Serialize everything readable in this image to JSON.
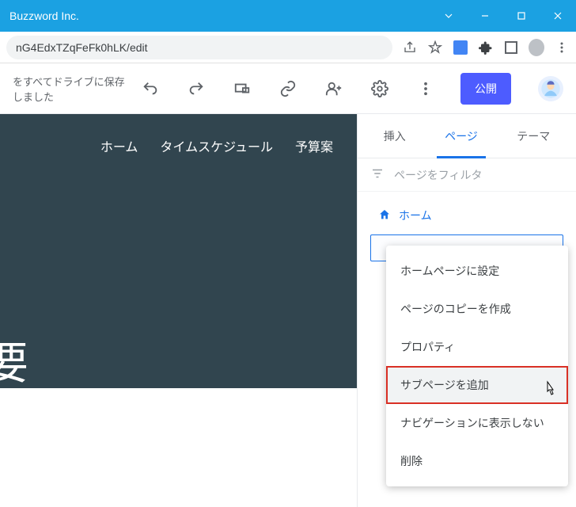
{
  "window": {
    "title": "Buzzword Inc."
  },
  "url": {
    "value": "nG4EdxTZqFeFk0hLK/edit"
  },
  "toolbar": {
    "save_status": "をすべてドライブに保存しました",
    "publish_label": "公開"
  },
  "canvas": {
    "nav": [
      "ホーム",
      "タイムスケジュール",
      "予算案"
    ],
    "title": "要"
  },
  "tabs": {
    "insert": "挿入",
    "pages": "ページ",
    "theme": "テーマ",
    "active": "pages"
  },
  "filter": {
    "placeholder": "ページをフィルタ"
  },
  "pages": {
    "home": "ホーム"
  },
  "context_menu": {
    "items": [
      "ホームページに設定",
      "ページのコピーを作成",
      "プロパティ",
      "サブページを追加",
      "ナビゲーションに表示しない",
      "削除"
    ],
    "highlighted_index": 3
  }
}
